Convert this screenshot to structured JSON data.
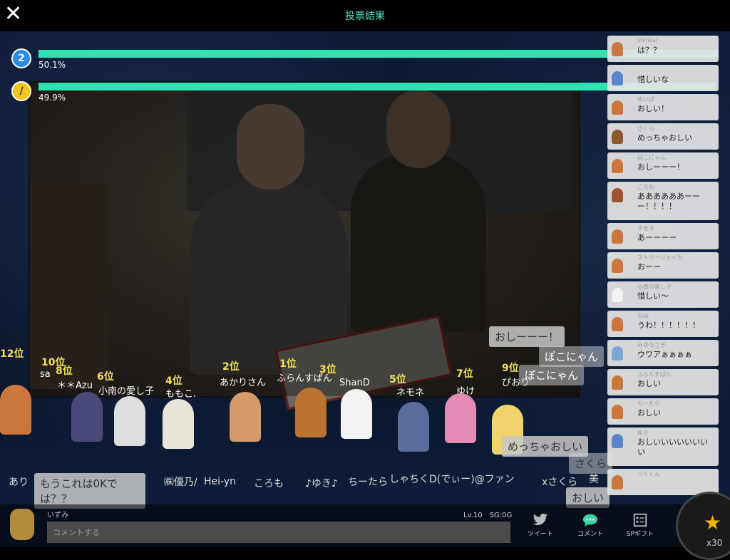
{
  "header": {
    "title": "投票結果"
  },
  "poll": [
    {
      "icon_text": "2",
      "percent_label": "50.1%",
      "fraction": 0.501
    },
    {
      "icon_text": "/",
      "percent_label": "49.9%",
      "fraction": 0.499
    }
  ],
  "ranks": [
    {
      "rank": "12位",
      "name": ""
    },
    {
      "rank": "10位",
      "name": "sa"
    },
    {
      "rank": "8位",
      "name": "＊＊Azu"
    },
    {
      "rank": "6位",
      "name": "小南の愛し子"
    },
    {
      "rank": "4位",
      "name": "ももこ."
    },
    {
      "rank": "2位",
      "name": "あかりさん"
    },
    {
      "rank": "1位",
      "name": "ふらんすぱん"
    },
    {
      "rank": "3位",
      "name": "ShanD"
    },
    {
      "rank": "5位",
      "name": "ネモネ"
    },
    {
      "rank": "7位",
      "name": "ゆけ"
    },
    {
      "rank": "9位",
      "name": "ぴおり"
    }
  ],
  "lower_names": [
    "あり",
    "㈱優乃/",
    "Hei-yn",
    "ころも",
    "♪ゆき♪",
    "ちーたら",
    "しゃちくD(でぃー)@ファン",
    "xさくら",
    "美"
  ],
  "floating_comments": [
    {
      "text": "おしーーー！"
    },
    {
      "text": "ぽこにゃん"
    },
    {
      "text": "ぽこにゃん"
    },
    {
      "text": "めっちゃおしい"
    },
    {
      "text": "さくら"
    },
    {
      "text": "おしい"
    },
    {
      "text": "もうこれは0Kで は？？"
    }
  ],
  "comments": [
    {
      "user": "shinkai",
      "msg": "は？？"
    },
    {
      "user": "",
      "msg": "惜しいな"
    },
    {
      "user": "ゆいぽ",
      "msg": "おしい！"
    },
    {
      "user": "さくら",
      "msg": "めっちゃおしい"
    },
    {
      "user": "ぽこにゃん",
      "msg": "おしーーー！"
    },
    {
      "user": "ころも",
      "msg": "ああああああーーー！！！！"
    },
    {
      "user": "ネモネ",
      "msg": "あーーーー"
    },
    {
      "user": "ストリージェイカ",
      "msg": "おーー"
    },
    {
      "user": "小南の愛し子",
      "msg": "惜しい〜"
    },
    {
      "user": "なぽ",
      "msg": "うわ！！！！！！"
    },
    {
      "user": "みゆうさぎ",
      "msg": "ウワアぁぁぁぁ"
    },
    {
      "user": "ふらんすぱん",
      "msg": "おしい"
    },
    {
      "user": "ちーたら",
      "msg": "おしい"
    },
    {
      "user": "ゆき",
      "msg": "おしいいいいいいいい"
    },
    {
      "user": "ワくくん",
      "msg": ""
    }
  ],
  "bottom": {
    "username": "いずみ",
    "level": "Lv.10　SG:0G",
    "input_placeholder": "コメントする",
    "tweet_label": "ツイート",
    "comment_label": "コメント",
    "gift_label": "SPギフト",
    "star_count": "x30"
  }
}
